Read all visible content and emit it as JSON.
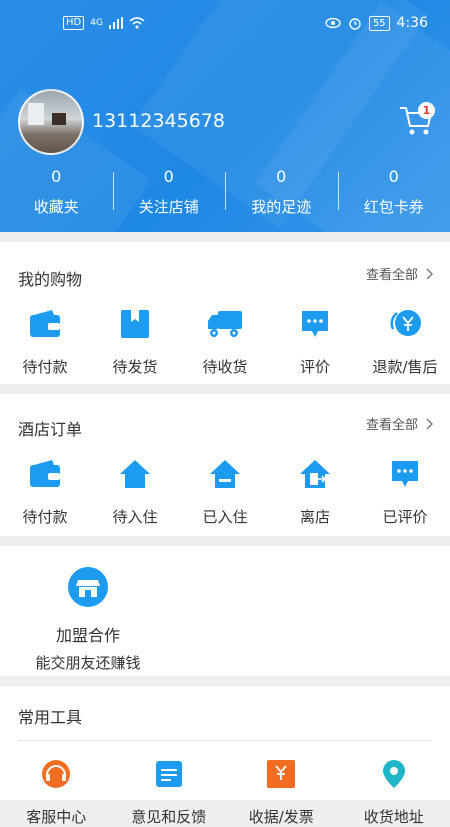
{
  "status_bar": {
    "hd": "HD",
    "network": "4G",
    "battery": "55",
    "time": "4:36"
  },
  "profile": {
    "phone": "13112345678",
    "cart_badge": "1"
  },
  "stats": [
    {
      "value": "0",
      "label": "收藏夹"
    },
    {
      "value": "0",
      "label": "关注店铺"
    },
    {
      "value": "0",
      "label": "我的足迹"
    },
    {
      "value": "0",
      "label": "红包卡券"
    }
  ],
  "shopping": {
    "title": "我的购物",
    "view_all": "查看全部",
    "items": [
      {
        "label": "待付款",
        "icon": "wallet-icon"
      },
      {
        "label": "待发货",
        "icon": "package-icon"
      },
      {
        "label": "待收货",
        "icon": "truck-icon"
      },
      {
        "label": "评价",
        "icon": "comment-icon"
      },
      {
        "label": "退款/售后",
        "icon": "refund-icon"
      }
    ]
  },
  "hotel": {
    "title": "酒店订单",
    "view_all": "查看全部",
    "items": [
      {
        "label": "待付款",
        "icon": "wallet-icon"
      },
      {
        "label": "待入住",
        "icon": "house-icon"
      },
      {
        "label": "已入住",
        "icon": "house-checked-icon"
      },
      {
        "label": "离店",
        "icon": "checkout-door-icon"
      },
      {
        "label": "已评价",
        "icon": "comment-icon"
      }
    ]
  },
  "join": {
    "title": "加盟合作",
    "subtitle": "能交朋友还赚钱",
    "icon": "store-icon"
  },
  "tools": {
    "title": "常用工具",
    "items": [
      {
        "label": "客服中心",
        "icon": "headset-icon"
      },
      {
        "label": "意见和反馈",
        "icon": "feedback-icon"
      },
      {
        "label": "收据/发票",
        "icon": "invoice-icon"
      },
      {
        "label": "收货地址",
        "icon": "location-pin-icon"
      }
    ]
  },
  "colors": {
    "brand_blue": "#1e88e5",
    "icon_blue": "#1c9bf0",
    "badge_red": "#e53935",
    "tool_orange": "#f26c21",
    "tool_teal": "#1fb5c8"
  }
}
